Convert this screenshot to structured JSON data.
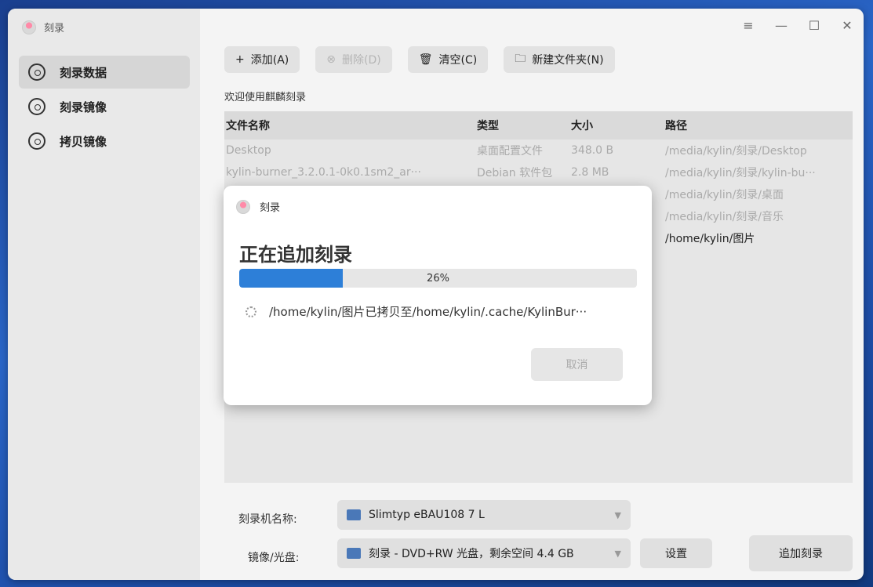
{
  "app": {
    "title": "刻录"
  },
  "sidebar": {
    "items": [
      {
        "label": "刻录数据",
        "icon": "data-disc-icon"
      },
      {
        "label": "刻录镜像",
        "icon": "image-disc-icon"
      },
      {
        "label": "拷贝镜像",
        "icon": "copy-disc-icon"
      }
    ]
  },
  "window_controls": {
    "menu": "≡",
    "minimize": "—",
    "maximize": "☐",
    "close": "✕"
  },
  "toolbar": {
    "add_label": "添加(A)",
    "delete_label": "删除(D)",
    "clear_label": "清空(C)",
    "new_folder_label": "新建文件夹(N)"
  },
  "welcome_text": "欢迎使用麒麟刻录",
  "table": {
    "headers": {
      "name": "文件名称",
      "type": "类型",
      "size": "大小",
      "path": "路径"
    },
    "rows": [
      {
        "name": "Desktop",
        "type": "桌面配置文件",
        "size": "348.0 B",
        "path": "/media/kylin/刻录/Desktop"
      },
      {
        "name": "kylin-burner_3.2.0.1-0k0.1sm2_ar···",
        "type": "Debian 软件包",
        "size": "2.8 MB",
        "path": "/media/kylin/刻录/kylin-bu···"
      },
      {
        "name": "",
        "type": "",
        "size": "",
        "path": "/media/kylin/刻录/桌面"
      },
      {
        "name": "",
        "type": "",
        "size": "",
        "path": "/media/kylin/刻录/音乐"
      },
      {
        "name": "",
        "type": "",
        "size": "",
        "path": "/home/kylin/图片"
      }
    ]
  },
  "bottom": {
    "burner_label": "刻录机名称:",
    "burner_value": "Slimtyp eBAU108  7 L",
    "image_label": "镜像/光盘:",
    "image_value": "刻录 - DVD+RW 光盘，剩余空间 4.4 GB",
    "settings_label": "设置",
    "append_label": "追加刻录"
  },
  "dialog": {
    "title": "刻录",
    "heading": "正在追加刻录",
    "progress_percent": 26,
    "progress_text": "26%",
    "message": "/home/kylin/图片已拷贝至/home/kylin/.cache/KylinBur···",
    "cancel_label": "取消"
  }
}
